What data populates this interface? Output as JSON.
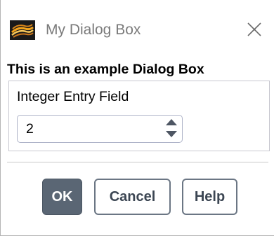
{
  "window": {
    "title": "My Dialog Box",
    "icon": "ansys-fluent-logo-icon",
    "close_icon": "close-icon"
  },
  "dialog": {
    "heading": "This is an example Dialog Box"
  },
  "integer_field": {
    "label": "Integer Entry Field",
    "value": "2"
  },
  "buttons": {
    "ok_label": "OK",
    "cancel_label": "Cancel",
    "help_label": "Help"
  },
  "colors": {
    "ok_button": "#5a6674",
    "button_text": "#3c4653",
    "title_text": "#7a7a7a"
  }
}
